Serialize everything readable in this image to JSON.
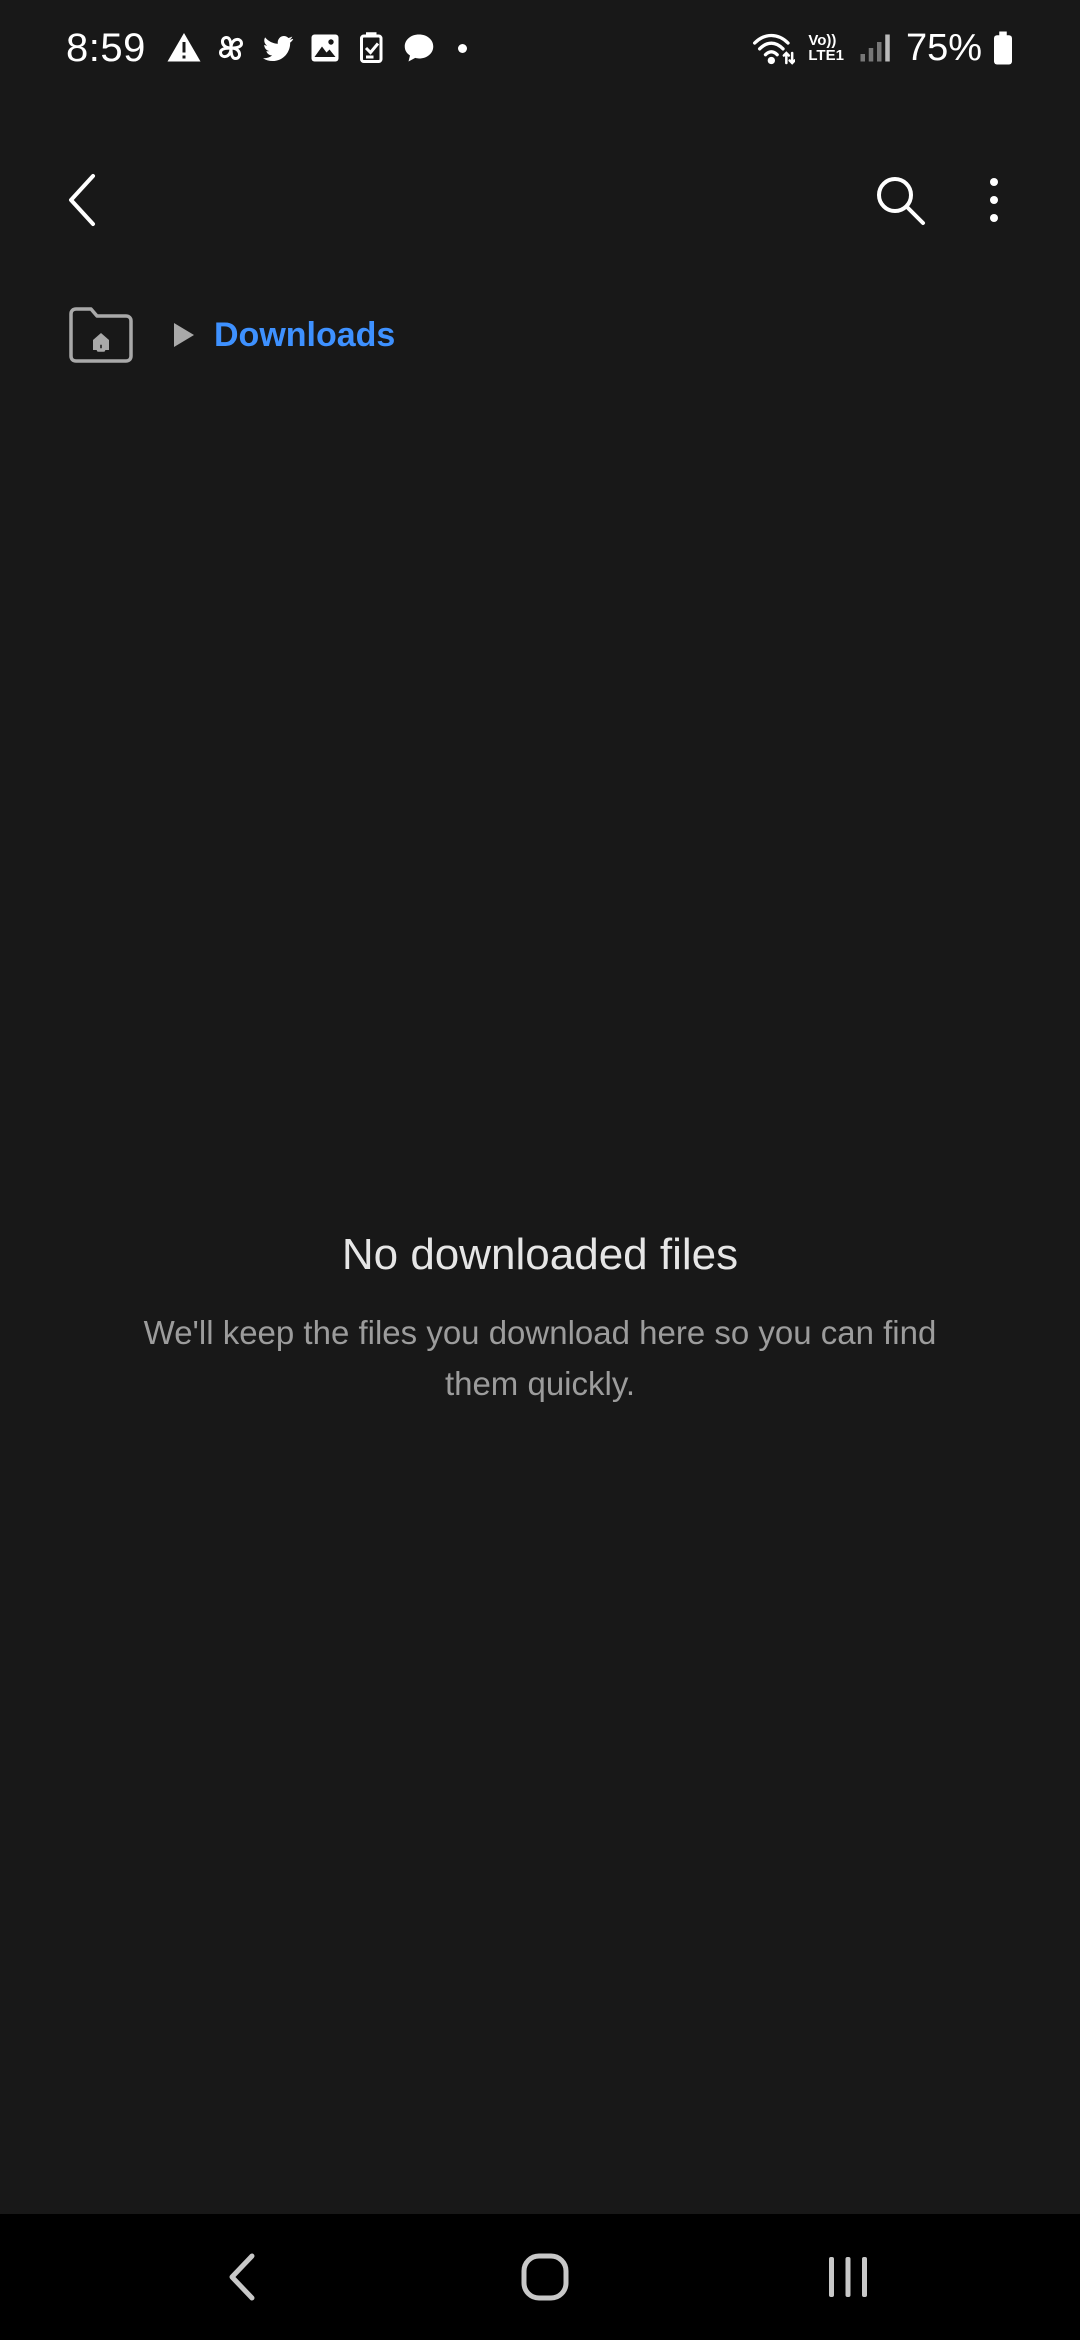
{
  "status_bar": {
    "time": "8:59",
    "lte_top": "Vo))",
    "lte_bottom": "LTE1",
    "battery_percent": "75%",
    "left_icons": [
      "alert-icon",
      "pinwheel-icon",
      "twitter-icon",
      "gallery-icon",
      "clipboard-check-icon",
      "chat-bubble-icon",
      "notification-dot"
    ],
    "right_icons": [
      "wifi-icon",
      "volte-lte-icon",
      "signal-icon",
      "battery-icon"
    ]
  },
  "app_bar": {
    "icons": [
      "back-arrow-icon",
      "search-icon",
      "more-vertical-icon"
    ]
  },
  "breadcrumb": {
    "current": "Downloads",
    "current_color": "#3e91ff"
  },
  "empty_state": {
    "title": "No downloaded files",
    "description": "We'll keep the files you download here so you can find them quickly."
  },
  "nav_bar": {
    "icons": [
      "nav-back-icon",
      "nav-home-icon",
      "nav-recents-icon"
    ]
  },
  "colors": {
    "background": "#181818",
    "nav_background": "#000000",
    "accent": "#3e91ff",
    "title_text": "#e6e6e6",
    "secondary_text": "#9c9c9c"
  }
}
